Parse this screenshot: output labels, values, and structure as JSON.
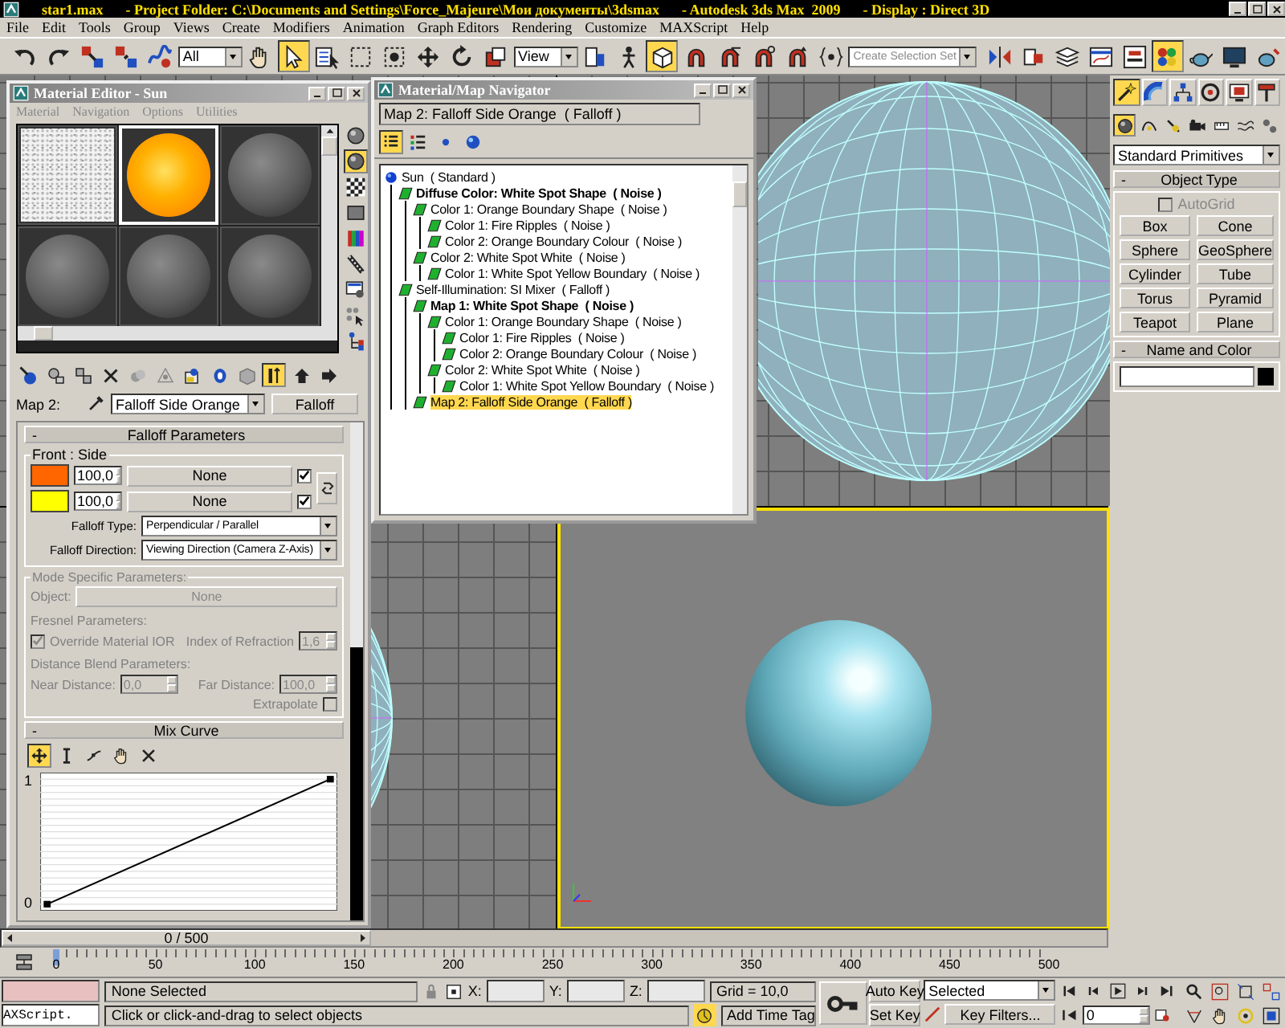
{
  "title_bar": [
    "star1.max",
    "- Project Folder: C:\\Documents and Settings\\Force_Majeure\\Мои документы\\3dsmax",
    "- Autodesk 3ds Max  2009",
    "- Display : Direct 3D"
  ],
  "menu": [
    "File",
    "Edit",
    "Tools",
    "Group",
    "Views",
    "Create",
    "Modifiers",
    "Animation",
    "Graph Editors",
    "Rendering",
    "Customize",
    "MAXScript",
    "Help"
  ],
  "toolbar": [
    {
      "kind": "undo",
      "selected": false
    },
    {
      "kind": "redo",
      "selected": false
    },
    {
      "kind": "link",
      "selected": false
    },
    {
      "kind": "unlink",
      "selected": false
    },
    {
      "kind": "bind",
      "selected": false
    },
    {
      "kind": "dropdown",
      "value": "All"
    },
    {
      "kind": "hand",
      "selected": false
    },
    {
      "kind": "select",
      "selected": true
    },
    {
      "kind": "selbyname",
      "selected": false
    },
    {
      "kind": "rect",
      "selected": false
    },
    {
      "kind": "window",
      "selected": false
    },
    {
      "kind": "move",
      "selected": false
    },
    {
      "kind": "rotate",
      "selected": false
    },
    {
      "kind": "scale",
      "selected": false
    },
    {
      "kind": "dropdown",
      "value": "View"
    },
    {
      "kind": "pivot",
      "selected": false
    },
    {
      "kind": "manip",
      "selected": false
    },
    {
      "kind": "cube",
      "selected": true
    },
    {
      "kind": "snap",
      "selected": false
    },
    {
      "kind": "angle",
      "selected": false
    },
    {
      "kind": "percent",
      "selected": false
    },
    {
      "kind": "spinner",
      "selected": false
    },
    {
      "kind": "namedsel",
      "selected": false
    },
    {
      "kind": "combo",
      "placeholder": "Create Selection Set"
    },
    {
      "kind": "mirror",
      "selected": false
    },
    {
      "kind": "align",
      "selected": false
    },
    {
      "kind": "layers",
      "selected": false
    },
    {
      "kind": "curve",
      "selected": false
    },
    {
      "kind": "schematic",
      "selected": false
    },
    {
      "kind": "material",
      "selected": true
    },
    {
      "kind": "teapot",
      "selected": false
    },
    {
      "kind": "frame",
      "selected": false
    },
    {
      "kind": "render",
      "selected": false
    }
  ],
  "viewports": [
    {
      "kind": "grid",
      "selected": false
    },
    {
      "kind": "wireframe",
      "selected": false
    },
    {
      "kind": "wireframe-left",
      "selected": false
    },
    {
      "kind": "shaded",
      "selected": true
    }
  ],
  "material_editor": {
    "title": "Material Editor - Sun",
    "menu": [
      "Material",
      "Navigation",
      "Options",
      "Utilities"
    ],
    "slots": [
      {
        "kind": "noise",
        "selected": false
      },
      {
        "kind": "sun",
        "selected": true
      },
      {
        "kind": "blank",
        "selected": false
      },
      {
        "kind": "blank",
        "selected": false
      },
      {
        "kind": "blank",
        "selected": false
      },
      {
        "kind": "blank",
        "selected": false
      }
    ],
    "side_tools": [
      {
        "kind": "sampletype",
        "selected": false
      },
      {
        "kind": "backlight",
        "selected": true
      },
      {
        "kind": "checker",
        "selected": false
      },
      {
        "kind": "tiling",
        "selected": false
      },
      {
        "kind": "video",
        "selected": false
      },
      {
        "kind": "preview",
        "selected": false
      },
      {
        "kind": "options",
        "selected": false
      },
      {
        "kind": "selmat",
        "selected": false
      },
      {
        "kind": "nav",
        "selected": false
      }
    ],
    "tools": [
      {
        "kind": "get",
        "selected": false
      },
      {
        "kind": "put",
        "selected": false
      },
      {
        "kind": "assign",
        "selected": false
      },
      {
        "kind": "reset",
        "selected": false
      },
      {
        "kind": "copy",
        "selected": false
      },
      {
        "kind": "unique",
        "selected": false
      },
      {
        "kind": "library",
        "selected": false
      },
      {
        "kind": "effects",
        "selected": false
      },
      {
        "kind": "showmap",
        "selected": false
      },
      {
        "kind": "endresult",
        "selected": true
      },
      {
        "kind": "parent",
        "selected": false
      },
      {
        "kind": "sibling",
        "selected": false
      }
    ],
    "map_label": "Map 2:",
    "map_name": "Falloff Side Orange",
    "map_type": "Falloff",
    "falloff": {
      "sign": "-",
      "title": "Falloff Parameters",
      "group": "Front : Side",
      "rows": [
        {
          "color": "#ff6600",
          "amount": "100,0",
          "map": "None",
          "checked": true
        },
        {
          "color": "#ffff00",
          "amount": "100,0",
          "map": "None",
          "checked": true
        }
      ],
      "type_label": "Falloff Type:",
      "type": "Perpendicular / Parallel",
      "direction_label": "Falloff Direction:",
      "direction": "Viewing Direction (Camera Z-Axis)"
    },
    "mode": {
      "title": "Mode Specific Parameters:",
      "disabled": true,
      "object_label": "Object:",
      "object": "None",
      "fresnel_title": "Fresnel Parameters:",
      "override_label": "Override Material IOR",
      "override_checked": true,
      "ior_label": "Index of Refraction",
      "ior": "1,6",
      "distance_title": "Distance Blend Parameters:",
      "near_label": "Near Distance:",
      "near": "0,0",
      "far_label": "Far Distance:",
      "far": "100,0",
      "extrapolate_label": "Extrapolate",
      "extrapolate_checked": false
    },
    "mix_curve": {
      "sign": "-",
      "title": "Mix Curve",
      "tools": [
        {
          "kind": "move",
          "selected": true
        },
        {
          "kind": "scalept",
          "selected": false
        },
        {
          "kind": "addpt",
          "selected": false
        },
        {
          "kind": "hand",
          "selected": false
        },
        {
          "kind": "delete",
          "selected": false
        }
      ],
      "top_label": "1",
      "bottom_label": "0"
    }
  },
  "navigator": {
    "title": "Material/Map Navigator",
    "path": "Map 2: Falloff Side Orange  ( Falloff )",
    "views": [
      {
        "kind": "listview",
        "selected": true
      },
      {
        "kind": "listicons",
        "selected": false
      },
      {
        "kind": "smallicons",
        "selected": false
      },
      {
        "kind": "largeicons",
        "selected": false
      }
    ],
    "tree": [
      {
        "label": "Sun  ( Standard )",
        "kind": "material",
        "bold": false,
        "selected": false,
        "children": [
          {
            "label": "Diffuse Color: White Spot Shape  ( Noise )",
            "kind": "map",
            "bold": true,
            "selected": false,
            "children": [
              {
                "label": "Color 1: Orange Boundary Shape  ( Noise )",
                "kind": "map",
                "bold": false,
                "selected": false,
                "children": [
                  {
                    "label": "Color 1: Fire Ripples  ( Noise )",
                    "kind": "map",
                    "bold": false,
                    "selected": false
                  },
                  {
                    "label": "Color 2: Orange Boundary Colour  ( Noise )",
                    "kind": "map",
                    "bold": false,
                    "selected": false
                  }
                ]
              },
              {
                "label": "Color 2: White Spot White  ( Noise )",
                "kind": "map",
                "bold": false,
                "selected": false,
                "children": [
                  {
                    "label": "Color 1: White Spot Yellow Boundary  ( Noise )",
                    "kind": "map",
                    "bold": false,
                    "selected": false
                  }
                ]
              }
            ]
          },
          {
            "label": "Self-Illumination: SI Mixer  ( Falloff )",
            "kind": "map",
            "bold": false,
            "selected": false,
            "children": [
              {
                "label": "Map 1: White Spot Shape  ( Noise )",
                "kind": "map",
                "bold": true,
                "selected": false,
                "children": [
                  {
                    "label": "Color 1: Orange Boundary Shape  ( Noise )",
                    "kind": "map",
                    "bold": false,
                    "selected": false,
                    "children": [
                      {
                        "label": "Color 1: Fire Ripples  ( Noise )",
                        "kind": "map",
                        "bold": false,
                        "selected": false
                      },
                      {
                        "label": "Color 2: Orange Boundary Colour  ( Noise )",
                        "kind": "map",
                        "bold": false,
                        "selected": false
                      }
                    ]
                  },
                  {
                    "label": "Color 2: White Spot White  ( Noise )",
                    "kind": "map",
                    "bold": false,
                    "selected": false,
                    "children": [
                      {
                        "label": "Color 1: White Spot Yellow Boundary  ( Noise )",
                        "kind": "map",
                        "bold": false,
                        "selected": false
                      }
                    ]
                  }
                ]
              },
              {
                "label": "Map 2: Falloff Side Orange  ( Falloff )",
                "kind": "map",
                "bold": false,
                "selected": true
              }
            ]
          }
        ]
      }
    ]
  },
  "command_panel": {
    "tabs": [
      {
        "kind": "create",
        "selected": true
      },
      {
        "kind": "modify",
        "selected": false
      },
      {
        "kind": "hierarchy",
        "selected": false
      },
      {
        "kind": "motion",
        "selected": false
      },
      {
        "kind": "display",
        "selected": false
      },
      {
        "kind": "utilities",
        "selected": false
      }
    ],
    "categories": [
      {
        "kind": "geometry",
        "selected": true
      },
      {
        "kind": "shapes",
        "selected": false
      },
      {
        "kind": "lights",
        "selected": false
      },
      {
        "kind": "cameras",
        "selected": false
      },
      {
        "kind": "helpers",
        "selected": false
      },
      {
        "kind": "spacewarps",
        "selected": false
      },
      {
        "kind": "systems",
        "selected": false
      }
    ],
    "type": "Standard Primitives",
    "object_type": {
      "sign": "-",
      "title": "Object Type",
      "autogrid": {
        "label": "AutoGrid",
        "checked": false,
        "disabled": true
      },
      "buttons": [
        "Box",
        "Cone",
        "Sphere",
        "GeoSphere",
        "Cylinder",
        "Tube",
        "Torus",
        "Pyramid",
        "Teapot",
        "Plane"
      ]
    },
    "name_color": {
      "sign": "-",
      "title": "Name and Color",
      "color": "#000000"
    }
  },
  "timeline": {
    "frame_label": "0 / 500",
    "level": 0,
    "ticks": [
      "0",
      "50",
      "100",
      "150",
      "200",
      "250",
      "300",
      "350",
      "400",
      "450",
      "500"
    ]
  },
  "status": {
    "listener": "AXScript.",
    "selection": "None Selected",
    "x_label": "X:",
    "y_label": "Y:",
    "z_label": "Z:",
    "grid": "Grid = 10,0",
    "prompt": "Click or click-and-drag to select objects",
    "time_tag": "Add Time Tag",
    "auto_key": "Auto Key",
    "set_key": "Set Key",
    "key_set": "Selected",
    "key_filters": "Key Filters...",
    "frame": "0"
  }
}
